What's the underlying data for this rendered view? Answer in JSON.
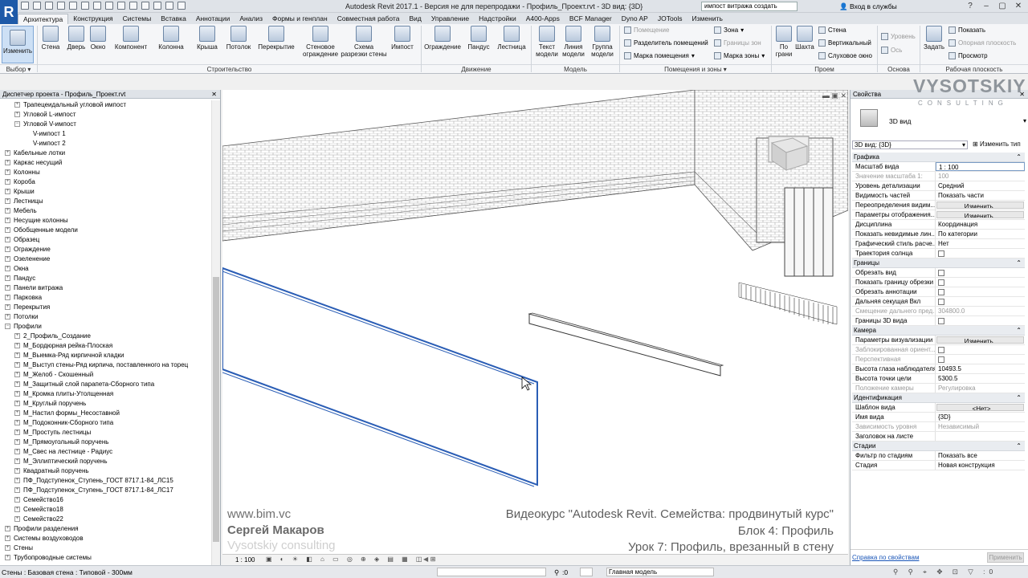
{
  "app": {
    "logo": "R",
    "title": "Autodesk Revit 2017.1 - Версия не для перепродажи -    Профиль_Проект.rvt - 3D вид: {3D}",
    "search_value": "импост витража создать",
    "login": "Вход в службы",
    "help": "?"
  },
  "tabs": [
    "Архитектура",
    "Конструкция",
    "Системы",
    "Вставка",
    "Аннотации",
    "Анализ",
    "Формы и генплан",
    "Совместная работа",
    "Вид",
    "Управление",
    "Надстройки",
    "A400-Apps",
    "BCF Manager",
    "Dyno AP",
    "JOTools",
    "Изменить"
  ],
  "ribbon": {
    "modify": "Изменить",
    "build": [
      "Стена",
      "Дверь",
      "Окно",
      "Компонент",
      "Колонна",
      "Крыша",
      "Потолок",
      "Перекрытие",
      "Стеновое ограждение",
      "Схема разрезки стены",
      "Импост"
    ],
    "circulation": [
      "Ограждение",
      "Пандус",
      "Лестница"
    ],
    "model": [
      "Текст модели",
      "Линия модели",
      "Группа модели"
    ],
    "room_items": [
      "Помещение",
      "Разделитель помещений",
      "Марка помещения",
      "Зона",
      "Границы зон",
      "Марка зоны"
    ],
    "opening_items": [
      "По грани",
      "Шахта",
      "Стена",
      "Вертикальный",
      "Слуховое окно"
    ],
    "datum_items": [
      "Уровень",
      "Ось"
    ],
    "workplane_items": [
      "Задать",
      "Показать",
      "Опорная плоскость",
      "Просмотр"
    ],
    "groups": [
      "Выбор",
      "Строительство",
      "Движение",
      "Модель",
      "Помещения и зоны",
      "Проем",
      "Основа",
      "Рабочая плоскость"
    ]
  },
  "brand": {
    "name": "VYSOTSKIY",
    "sub": "CONSULTING"
  },
  "browser": {
    "title": "Диспетчер проекта - Профиль_Проект.rvt",
    "items": [
      {
        "label": "Трапецеидальный угловой импост",
        "level": 2,
        "pm": "+"
      },
      {
        "label": "Угловой L-импост",
        "level": 2,
        "pm": "+"
      },
      {
        "label": "Угловой V-импост",
        "level": 2,
        "pm": "−"
      },
      {
        "label": "V-импост 1",
        "level": 3,
        "pm": ""
      },
      {
        "label": "V-импост 2",
        "level": 3,
        "pm": ""
      },
      {
        "label": "Кабельные лотки",
        "level": 1,
        "pm": "+"
      },
      {
        "label": "Каркас несущий",
        "level": 1,
        "pm": "+"
      },
      {
        "label": "Колонны",
        "level": 1,
        "pm": "+"
      },
      {
        "label": "Короба",
        "level": 1,
        "pm": "+"
      },
      {
        "label": "Крыши",
        "level": 1,
        "pm": "+"
      },
      {
        "label": "Лестницы",
        "level": 1,
        "pm": "+"
      },
      {
        "label": "Мебель",
        "level": 1,
        "pm": "+"
      },
      {
        "label": "Несущие колонны",
        "level": 1,
        "pm": "+"
      },
      {
        "label": "Обобщенные модели",
        "level": 1,
        "pm": "+"
      },
      {
        "label": "Образец",
        "level": 1,
        "pm": "+"
      },
      {
        "label": "Ограждение",
        "level": 1,
        "pm": "+"
      },
      {
        "label": "Озеленение",
        "level": 1,
        "pm": "+"
      },
      {
        "label": "Окна",
        "level": 1,
        "pm": "+"
      },
      {
        "label": "Пандус",
        "level": 1,
        "pm": "+"
      },
      {
        "label": "Панели витража",
        "level": 1,
        "pm": "+"
      },
      {
        "label": "Парковка",
        "level": 1,
        "pm": "+"
      },
      {
        "label": "Перекрытия",
        "level": 1,
        "pm": "+"
      },
      {
        "label": "Потолки",
        "level": 1,
        "pm": "+"
      },
      {
        "label": "Профили",
        "level": 1,
        "pm": "−"
      },
      {
        "label": "2_Профиль_Создание",
        "level": 2,
        "pm": "+"
      },
      {
        "label": "M_Бордюрная рейка-Плоская",
        "level": 2,
        "pm": "+"
      },
      {
        "label": "M_Выемка-Ряд кирпичной кладки",
        "level": 2,
        "pm": "+"
      },
      {
        "label": "M_Выступ стены-Ряд кирпича, поставленного на торец",
        "level": 2,
        "pm": "+"
      },
      {
        "label": "M_Желоб - Скошенный",
        "level": 2,
        "pm": "+"
      },
      {
        "label": "M_Защитный слой парапета-Сборного типа",
        "level": 2,
        "pm": "+"
      },
      {
        "label": "M_Кромка плиты-Утолщенная",
        "level": 2,
        "pm": "+"
      },
      {
        "label": "M_Круглый поручень",
        "level": 2,
        "pm": "+"
      },
      {
        "label": "M_Настил формы_Несоставной",
        "level": 2,
        "pm": "+"
      },
      {
        "label": "M_Подоконник-Сборного типа",
        "level": 2,
        "pm": "+"
      },
      {
        "label": "M_Проступь лестницы",
        "level": 2,
        "pm": "+"
      },
      {
        "label": "M_Прямоугольный поручень",
        "level": 2,
        "pm": "+"
      },
      {
        "label": "M_Свес на лестнице - Радиус",
        "level": 2,
        "pm": "+"
      },
      {
        "label": "M_Эллиптический поручень",
        "level": 2,
        "pm": "+"
      },
      {
        "label": "Квадратный поручень",
        "level": 2,
        "pm": "+"
      },
      {
        "label": "ПФ_Подступенок_Ступень_ГОСТ 8717.1-84_ЛС15",
        "level": 2,
        "pm": "+"
      },
      {
        "label": "ПФ_Подступенок_Ступень_ГОСТ 8717.1-84_ЛС17",
        "level": 2,
        "pm": "+"
      },
      {
        "label": "Семейство16",
        "level": 2,
        "pm": "+"
      },
      {
        "label": "Семейство18",
        "level": 2,
        "pm": "+"
      },
      {
        "label": "Семейство22",
        "level": 2,
        "pm": "+"
      },
      {
        "label": "Профили разделения",
        "level": 1,
        "pm": "+"
      },
      {
        "label": "Системы воздуховодов",
        "level": 1,
        "pm": "+"
      },
      {
        "label": "Стены",
        "level": 1,
        "pm": "+"
      },
      {
        "label": "Трубопроводные системы",
        "level": 1,
        "pm": "+"
      }
    ]
  },
  "overlay": {
    "site": "www.bim.vc",
    "author": "Сергей Макаров",
    "company": "Vysotskiy consulting",
    "course": "Видеокурс \"Autodesk Revit. Семейства: продвинутый курс\"",
    "block": "Блок 4: Профиль",
    "lesson": "Урок 7: Профиль, врезанный в стену"
  },
  "props": {
    "title": "Свойства",
    "type_name": "3D вид",
    "dropdown": "3D вид: {3D}",
    "edit_type": "Изменить тип",
    "sections": [
      {
        "name": "Графика",
        "rows": [
          {
            "k": "Масштаб вида",
            "v": "1 : 100",
            "input": true
          },
          {
            "k": "Значение масштаба   1:",
            "v": "100",
            "dis": true
          },
          {
            "k": "Уровень детализации",
            "v": "Средний"
          },
          {
            "k": "Видимость частей",
            "v": "Показать части"
          },
          {
            "k": "Переопределения видим...",
            "v": "Изменить...",
            "btn": true
          },
          {
            "k": "Параметры отображения...",
            "v": "Изменить...",
            "btn": true
          },
          {
            "k": "Дисциплина",
            "v": "Координация"
          },
          {
            "k": "Показать невидимые лин...",
            "v": "По категории"
          },
          {
            "k": "Графический стиль расче...",
            "v": "Нет"
          },
          {
            "k": "Траектория солнца",
            "v": "",
            "cb": true
          }
        ]
      },
      {
        "name": "Границы",
        "rows": [
          {
            "k": "Обрезать вид",
            "v": "",
            "cb": true
          },
          {
            "k": "Показать границу обрезки",
            "v": "",
            "cb": true
          },
          {
            "k": "Обрезать аннотации",
            "v": "",
            "cb": true
          },
          {
            "k": "Дальняя секущая Вкл",
            "v": "",
            "cb": true
          },
          {
            "k": "Смещение дальнего пред...",
            "v": "304800.0",
            "dis": true
          },
          {
            "k": "Границы 3D вида",
            "v": "",
            "cb": true
          }
        ]
      },
      {
        "name": "Камера",
        "rows": [
          {
            "k": "Параметры визуализации",
            "v": "Изменить...",
            "btn": true
          },
          {
            "k": "Заблокированная ориент...",
            "v": "",
            "cb": true,
            "dis": true
          },
          {
            "k": "Перспективная",
            "v": "",
            "cb": true,
            "dis": true
          },
          {
            "k": "Высота глаза наблюдателя",
            "v": "10493.5"
          },
          {
            "k": "Высота точки цели",
            "v": "5300.5"
          },
          {
            "k": "Положение камеры",
            "v": "Регулировка",
            "dis": true
          }
        ]
      },
      {
        "name": "Идентификация",
        "rows": [
          {
            "k": "Шаблон вида",
            "v": "<Нет>",
            "btn": true
          },
          {
            "k": "Имя вида",
            "v": "{3D}"
          },
          {
            "k": "Зависимость уровня",
            "v": "Независимый",
            "dis": true
          },
          {
            "k": "Заголовок на листе",
            "v": ""
          }
        ]
      },
      {
        "name": "Стадии",
        "rows": [
          {
            "k": "Фильтр по стадиям",
            "v": "Показать все"
          },
          {
            "k": "Стадия",
            "v": "Новая конструкция"
          }
        ]
      }
    ],
    "help_link": "Справка по свойствам",
    "apply": "Применить"
  },
  "viewctrl": {
    "scale": "1 : 100"
  },
  "status": {
    "text": "Стены : Базовая стена : Типовой - 300мм",
    "coord": ":0",
    "model": "Главная модель"
  },
  "colors": {
    "accent": "#1e5aa8",
    "selection": "#2a5db5"
  }
}
